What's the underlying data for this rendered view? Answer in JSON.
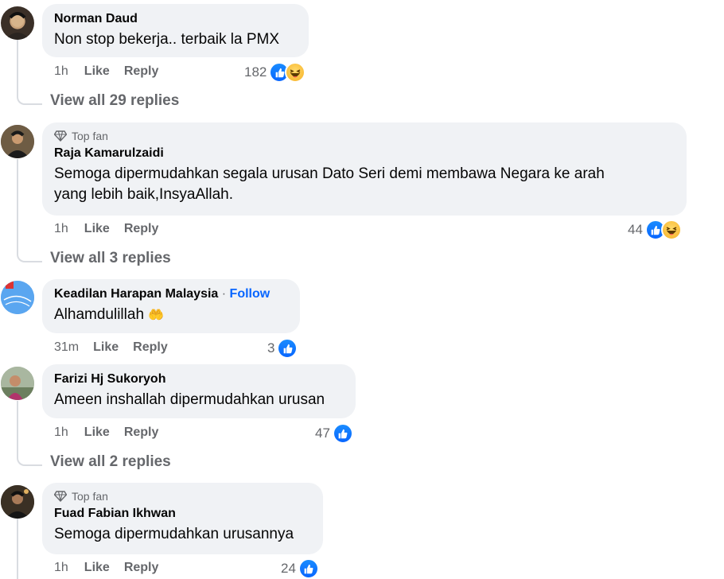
{
  "comments": [
    {
      "name": "Norman Daud",
      "text": "Non stop bekerja.. terbaik la PMX",
      "time": "1h",
      "like": "Like",
      "reply": "Reply",
      "reaction_count": "182",
      "reactions": [
        "like-icon",
        "haha-icon"
      ],
      "view_replies": "View all 29 replies"
    },
    {
      "badge": "Top fan",
      "name": "Raja Kamarulzaidi",
      "text_line1": "Semoga dipermudahkan segala urusan Dato Seri demi membawa Negara ke arah",
      "text_line2": "yang lebih baik,InsyaAllah.",
      "time": "1h",
      "like": "Like",
      "reply": "Reply",
      "reaction_count": "44",
      "reactions": [
        "like-icon",
        "haha-icon"
      ],
      "view_replies": "View all 3 replies"
    },
    {
      "name": "Keadilan Harapan Malaysia",
      "separator": "·",
      "follow": "Follow",
      "text": "Alhamdulillah",
      "emoji": "🤲",
      "time": "31m",
      "like": "Like",
      "reply": "Reply",
      "reaction_count": "3",
      "reactions": [
        "like-icon"
      ]
    },
    {
      "name": "Farizi Hj Sukoryoh",
      "text": "Ameen inshallah dipermudahkan urusan",
      "time": "1h",
      "like": "Like",
      "reply": "Reply",
      "reaction_count": "47",
      "reactions": [
        "like-icon"
      ],
      "view_replies": "View all 2 replies"
    },
    {
      "badge": "Top fan",
      "name": "Fuad Fabian Ikhwan",
      "text": "Semoga dipermudahkan urusannya",
      "time": "1h",
      "like": "Like",
      "reply": "Reply",
      "reaction_count": "24",
      "reactions": [
        "like-icon"
      ]
    }
  ],
  "colors": {
    "bubble": "#f0f2f5",
    "secondary_text": "#65676b",
    "like_blue": "#0866ff",
    "thread_line": "#d9dce1"
  }
}
